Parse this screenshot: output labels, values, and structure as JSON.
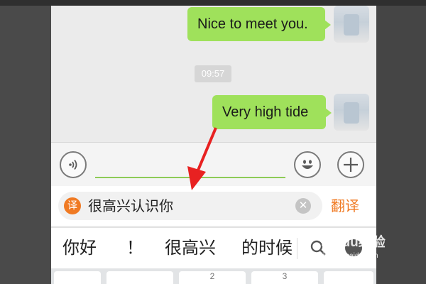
{
  "chat": {
    "messages": [
      {
        "text": "Nice to meet you."
      },
      {
        "text": "Very high tide"
      }
    ],
    "timestamp": "09:57"
  },
  "input": {
    "value": "",
    "voice_icon": "voice-icon",
    "emoji_icon": "emoji-icon",
    "plus_icon": "plus-icon"
  },
  "translate": {
    "badge": "译",
    "text": "很高兴认识你",
    "clear_icon": "clear-icon",
    "button_label": "翻译",
    "accent": "#f07a23"
  },
  "candidates": [
    "你好",
    "！",
    "很高兴",
    "的时候"
  ],
  "keyboard": {
    "keys": [
      "",
      "",
      "2",
      "3",
      ""
    ]
  },
  "watermark": {
    "logo": "Baidu经验",
    "url": "jingyan.baidu.com"
  },
  "colors": {
    "bubble": "#9fe15b",
    "pointer": "#e82121"
  }
}
